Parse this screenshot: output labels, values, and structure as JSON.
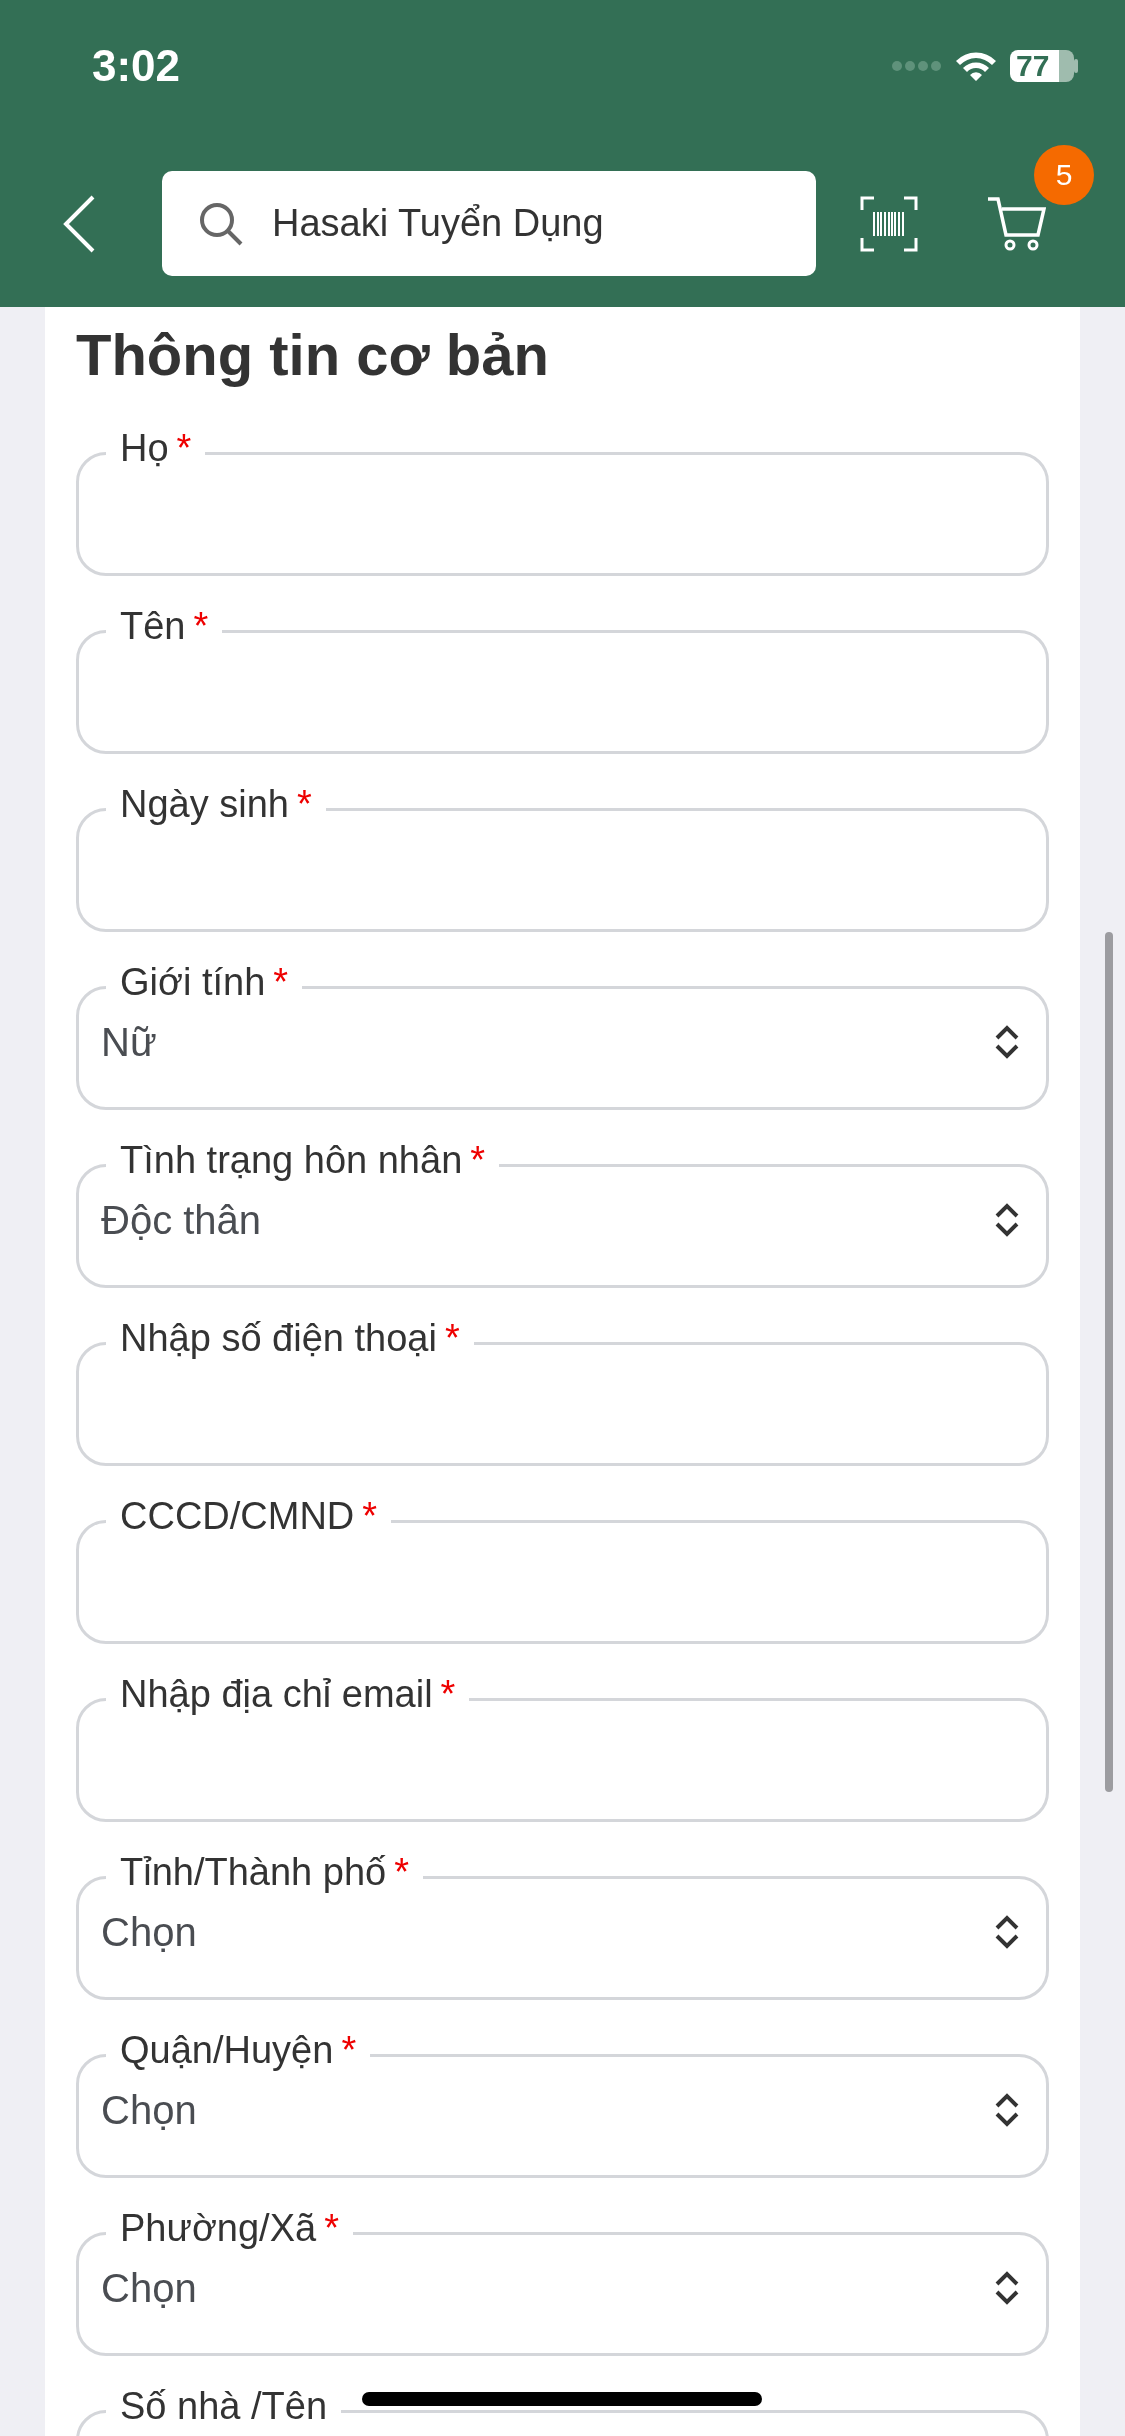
{
  "status_bar": {
    "time": "3:02",
    "battery": "77"
  },
  "header": {
    "search": {
      "value": "Hasaki Tuyển Dụng"
    },
    "cart_badge": "5"
  },
  "form": {
    "title": "Thông tin cơ bản",
    "fields": [
      {
        "kind": "text",
        "label": "Họ",
        "mark": "*"
      },
      {
        "kind": "text",
        "label": "Tên",
        "mark": "*"
      },
      {
        "kind": "text",
        "label": "Ngày sinh",
        "mark": "*"
      },
      {
        "kind": "select",
        "label": "Giới tính",
        "mark": "*",
        "value": "Nữ"
      },
      {
        "kind": "select",
        "label": "Tình trạng hôn nhân",
        "mark": "*",
        "value": "Độc thân"
      },
      {
        "kind": "text",
        "label": "Nhập số điện thoại",
        "mark": "*"
      },
      {
        "kind": "text",
        "label": "CCCD/CMND",
        "mark": "*"
      },
      {
        "kind": "text",
        "label": "Nhập địa chỉ email",
        "mark": "*"
      },
      {
        "kind": "select",
        "label": "Tỉnh/Thành phố",
        "mark": "*",
        "value": "Chọn"
      },
      {
        "kind": "select",
        "label": "Quận/Huyện",
        "mark": "*",
        "value": "Chọn"
      },
      {
        "kind": "select",
        "label": "Phường/Xã",
        "mark": "*",
        "value": "Chọn"
      },
      {
        "kind": "text",
        "label": "Số nhà /Tên"
      }
    ]
  }
}
